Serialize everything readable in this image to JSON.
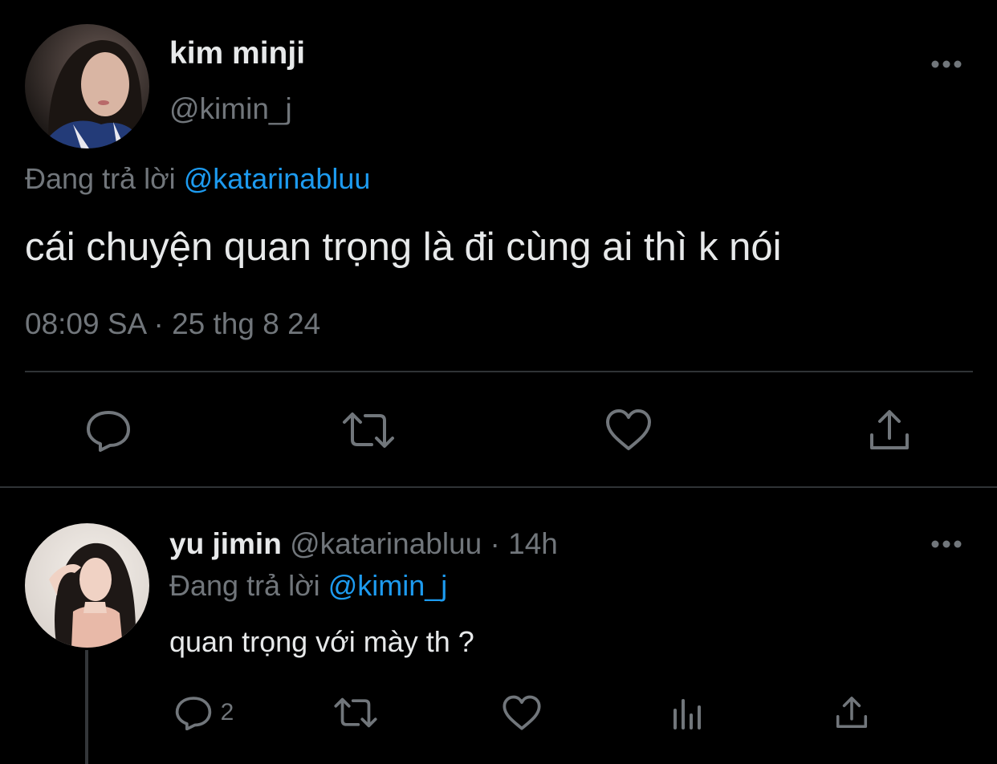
{
  "main_tweet": {
    "author_name": "kim minji",
    "author_handle": "@kimin_j",
    "replying_prefix": "Đang trả lời",
    "replying_to": "@katarinabluu",
    "text": "cái chuyện quan trọng là đi cùng ai thì k nói",
    "timestamp": "08:09 SA · 25 thg 8 24",
    "actions": [
      "reply-icon",
      "retweet-icon",
      "like-icon",
      "share-icon"
    ]
  },
  "reply_tweet": {
    "author_name": "yu jimin",
    "author_handle": "@katarinabluu",
    "separator": "·",
    "time_ago": "14h",
    "replying_prefix": "Đang trả lời",
    "replying_to": "@kimin_j",
    "text": "quan trọng với mày th ?",
    "reply_count": "2",
    "actions": [
      "reply-icon",
      "retweet-icon",
      "like-icon",
      "analytics-icon",
      "share-icon"
    ]
  },
  "colors": {
    "background": "#000000",
    "text_primary": "#E7E9EA",
    "text_secondary": "#71767B",
    "link": "#1D9BF0",
    "divider": "#2F3336"
  }
}
